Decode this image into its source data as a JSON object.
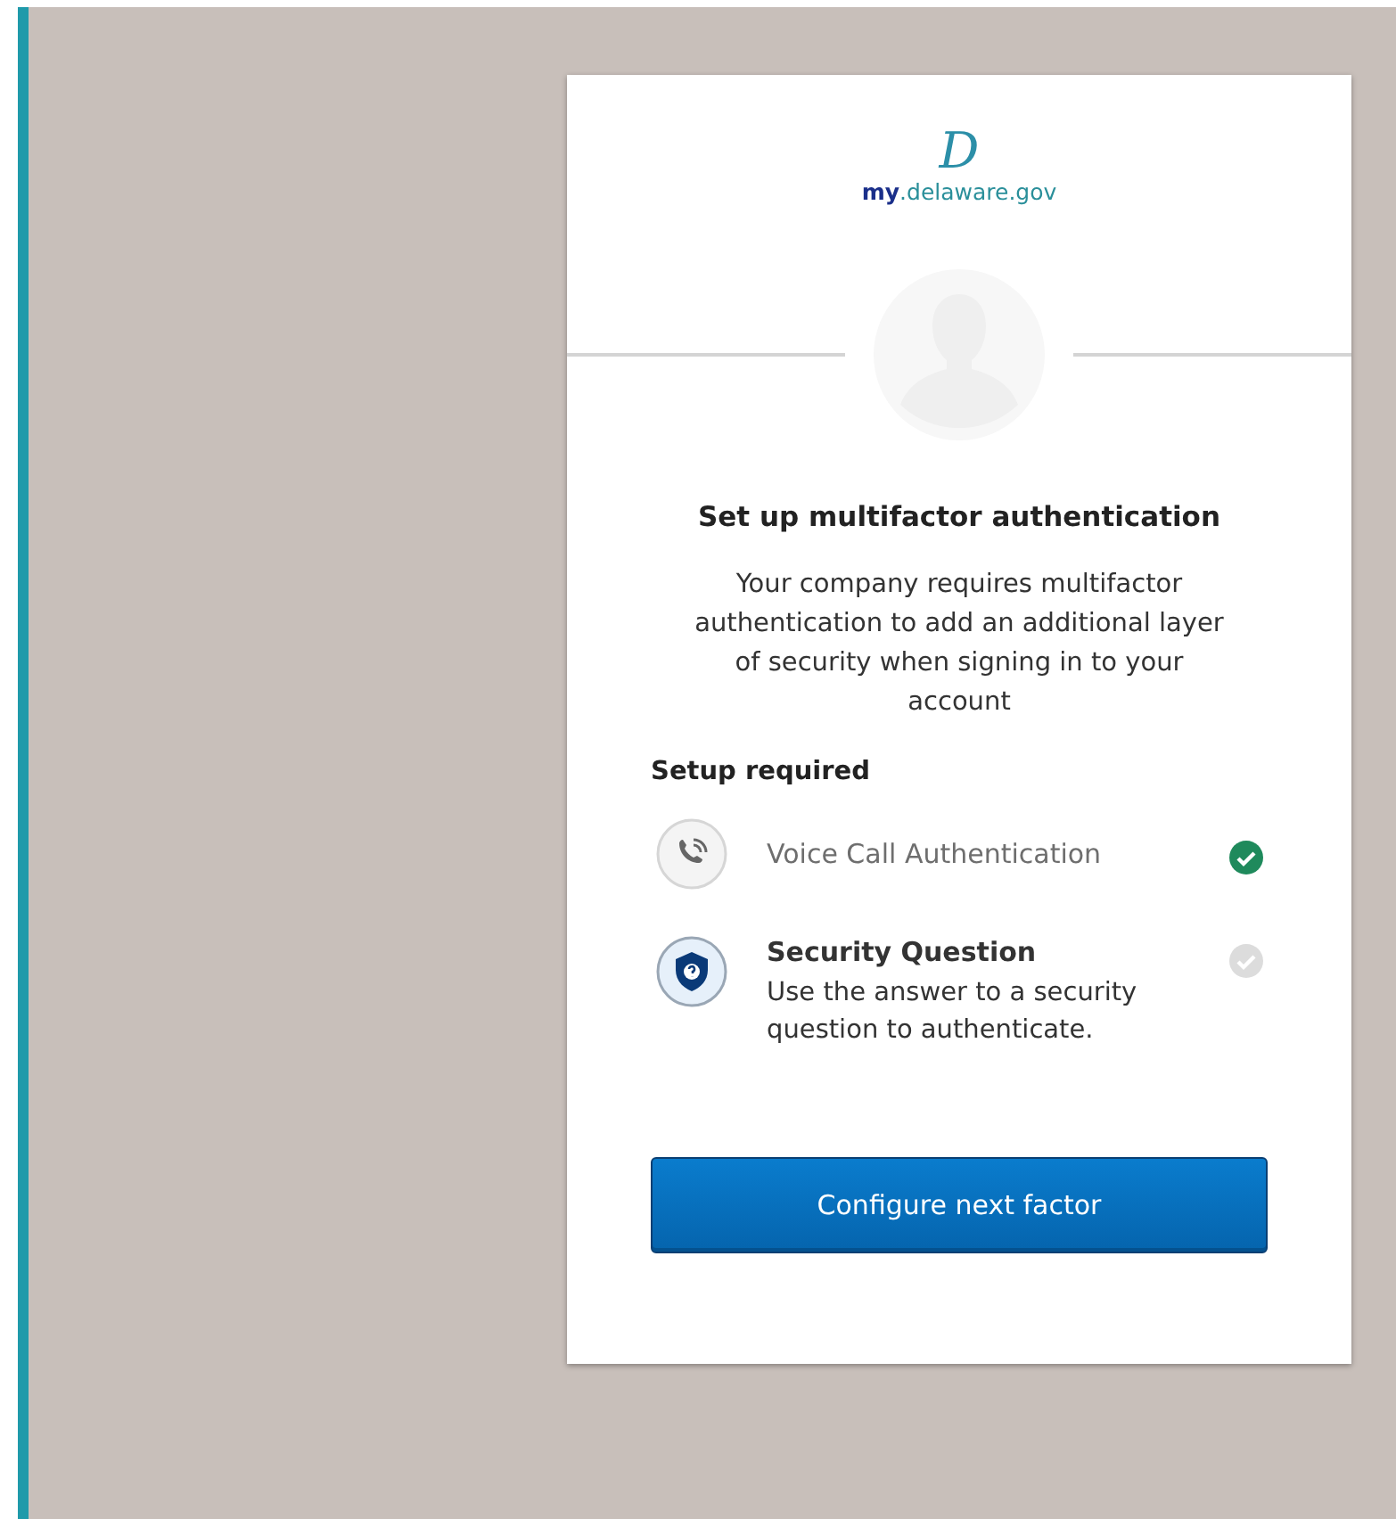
{
  "logo": {
    "mark": "D",
    "prefix": "my",
    "domain": ".delaware.gov"
  },
  "title": "Set up multifactor authentication",
  "description": "Your company requires multifactor authentication to add an additional layer of security when signing in to your account",
  "section_label": "Setup required",
  "factors": [
    {
      "kind": "phone",
      "name": "Voice Call Authentication",
      "completed": true
    },
    {
      "kind": "shield",
      "name": "Security Question",
      "description": "Use the answer to a security question to authenticate.",
      "completed": false
    }
  ],
  "button": "Configure next factor"
}
